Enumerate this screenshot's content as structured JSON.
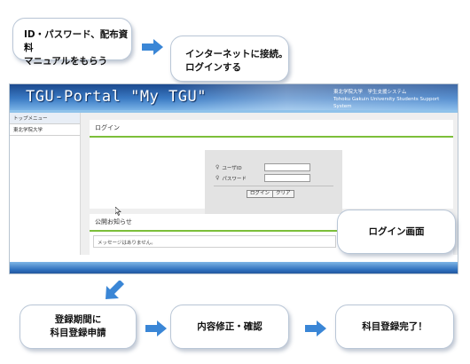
{
  "steps": {
    "step1": [
      "ID・パスワード、配布資料",
      "マニュアルをもらう"
    ],
    "step2": [
      "インターネットに接続。",
      "ログインする"
    ],
    "login_screen": "ログイン画面",
    "step3": [
      "登録期間に",
      "科目登録申請"
    ],
    "step4": "内容修正・確認",
    "step5": "科目登録完了！"
  },
  "portal": {
    "title": "TGU-Portal \"My TGU\"",
    "university_jp": "東北学院大学　学生支援システム",
    "university_en": "Tohoku Gakuin University Students Support System",
    "sidebar": {
      "items": [
        "トップメニュー",
        "東北学院大学"
      ]
    },
    "login": {
      "heading": "ログイン",
      "user_id_label": "ユーザID",
      "password_label": "パスワード",
      "login_button": "ログイン",
      "clear_button": "クリア"
    },
    "news": {
      "heading": "公開お知らせ",
      "message": "メッセージはありません。"
    }
  },
  "colors": {
    "arrow": "#3a86d6",
    "header_dark": "#1c4a8e",
    "accent_green": "#7cbf3a"
  },
  "icons": {
    "flow_arrow": "right-arrow-icon",
    "down_arrow": "down-left-arrow-icon",
    "person": "person-icon",
    "cursor": "mouse-cursor-icon"
  }
}
